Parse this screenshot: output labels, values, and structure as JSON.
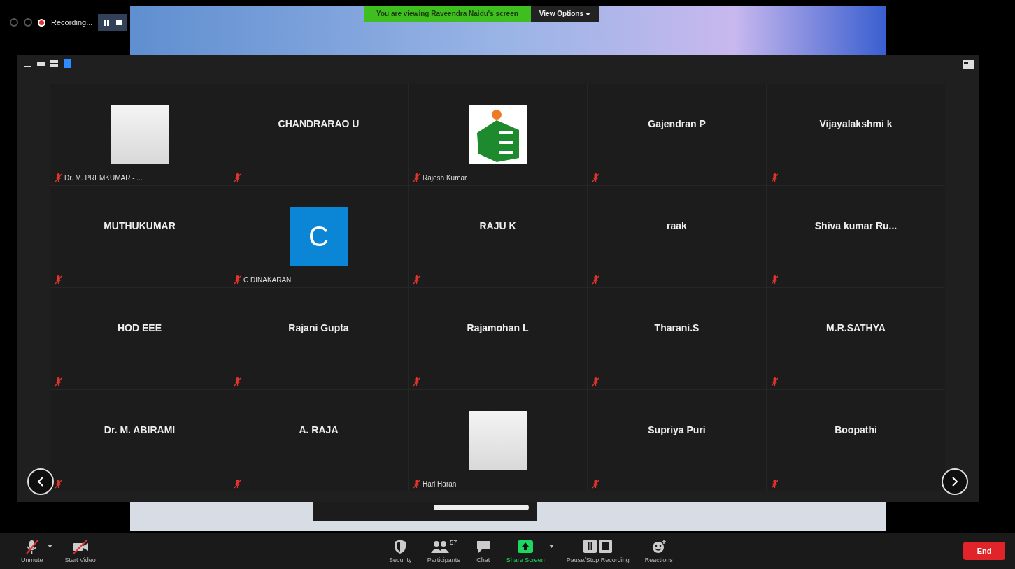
{
  "recording": {
    "label": "Recording..."
  },
  "share_banner": {
    "text": "You are viewing Raveendra Naidu's screen",
    "button": "View Options"
  },
  "view_modes": [
    {
      "kind": "minimize",
      "selected": false
    },
    {
      "kind": "speaker",
      "selected": false
    },
    {
      "kind": "strip",
      "selected": false
    },
    {
      "kind": "gallery",
      "selected": true
    }
  ],
  "participants": [
    {
      "name": "Dr. M. PREMKUMAR - ...",
      "kind": "photo",
      "muted": true
    },
    {
      "name": "CHANDRARAO U",
      "kind": "name",
      "muted": true
    },
    {
      "name": "Rajesh Kumar",
      "kind": "logo",
      "muted": true
    },
    {
      "name": "Gajendran P",
      "kind": "name",
      "muted": true
    },
    {
      "name": "Vijayalakshmi k",
      "kind": "name",
      "muted": true
    },
    {
      "name": "MUTHUKUMAR",
      "kind": "name",
      "muted": true
    },
    {
      "name": "C DINAKARAN",
      "kind": "avatar",
      "letter": "C",
      "color": "#0b85d6",
      "muted": true
    },
    {
      "name": "RAJU K",
      "kind": "name",
      "muted": true
    },
    {
      "name": "raak",
      "kind": "name",
      "muted": true
    },
    {
      "name": "Shiva kumar Ru...",
      "kind": "name",
      "muted": true
    },
    {
      "name": "HOD EEE",
      "kind": "name",
      "muted": true
    },
    {
      "name": "Rajani Gupta",
      "kind": "name",
      "muted": true
    },
    {
      "name": "Rajamohan L",
      "kind": "name",
      "muted": true
    },
    {
      "name": "Tharani.S",
      "kind": "name",
      "muted": true
    },
    {
      "name": "M.R.SATHYA",
      "kind": "name",
      "muted": true
    },
    {
      "name": "Dr. M. ABIRAMI",
      "kind": "name",
      "muted": true
    },
    {
      "name": "A. RAJA",
      "kind": "name",
      "muted": true
    },
    {
      "name": "Hari Haran",
      "kind": "photo",
      "muted": true
    },
    {
      "name": "Supriya Puri",
      "kind": "name",
      "muted": true
    },
    {
      "name": "Boopathi",
      "kind": "name",
      "muted": true
    }
  ],
  "toolbar": [
    {
      "kind": "mic",
      "label": "Unmute",
      "off": true,
      "caret": true
    },
    {
      "kind": "video",
      "label": "Start Video",
      "off": true
    },
    {
      "kind": "spacer"
    },
    {
      "kind": "security",
      "label": "Security"
    },
    {
      "kind": "participants",
      "label": "Participants",
      "count": "57"
    },
    {
      "kind": "chat",
      "label": "Chat"
    },
    {
      "kind": "share",
      "label": "Share Screen",
      "caret": true
    },
    {
      "kind": "record",
      "label": "Pause/Stop Recording"
    },
    {
      "kind": "reactions",
      "label": "Reactions"
    },
    {
      "kind": "spacer"
    },
    {
      "kind": "end",
      "label": "End"
    }
  ]
}
